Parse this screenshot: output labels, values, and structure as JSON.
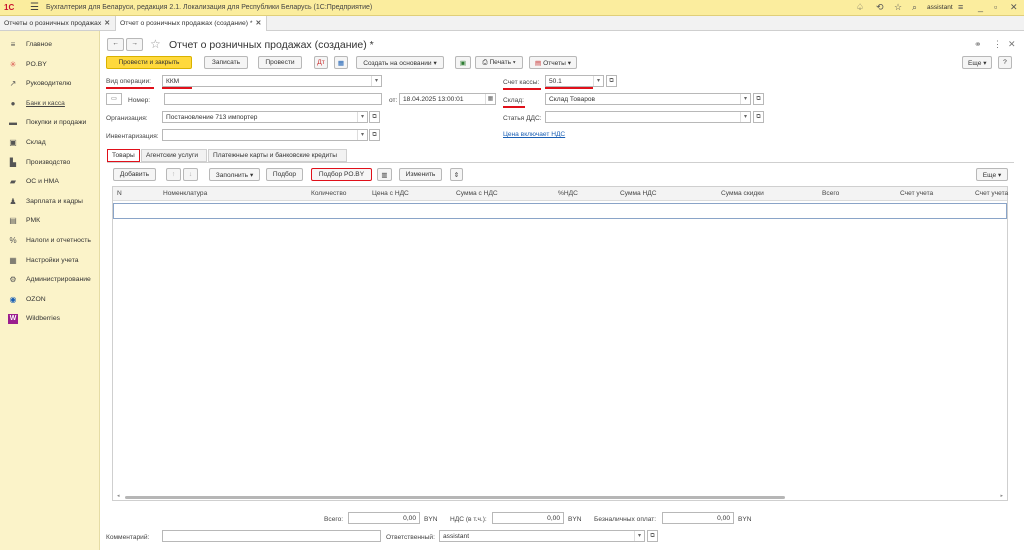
{
  "app": {
    "logo": "1С",
    "title": "Бухгалтерия для Беларуси, редакция 2.1. Локализация для Республики Беларусь  (1С:Предприятие)",
    "user": "assistant"
  },
  "tabs": [
    {
      "label": "Отчеты о розничных продажах"
    },
    {
      "label": "Отчет о розничных продажах (создание) *"
    }
  ],
  "sidebar": {
    "items": [
      {
        "label": "Главное",
        "icon": "≡"
      },
      {
        "label": "PO.BY",
        "icon": "✳"
      },
      {
        "label": "Руководителю",
        "icon": "↗"
      },
      {
        "label": "Банк и касса",
        "icon": "●"
      },
      {
        "label": "Покупки и продажи",
        "icon": "▬"
      },
      {
        "label": "Склад",
        "icon": "▣"
      },
      {
        "label": "Производство",
        "icon": "▙"
      },
      {
        "label": "ОС и НМА",
        "icon": "▰"
      },
      {
        "label": "Зарплата и кадры",
        "icon": "♟"
      },
      {
        "label": "РМК",
        "icon": "▤"
      },
      {
        "label": "Налоги и отчетность",
        "icon": "%"
      },
      {
        "label": "Настройки учета",
        "icon": "▦"
      },
      {
        "label": "Администрирование",
        "icon": "⚙"
      },
      {
        "label": "OZON",
        "icon": "◉"
      },
      {
        "label": "Wildberries",
        "icon": "W"
      }
    ]
  },
  "form": {
    "title": "Отчет о розничных продажах (создание) *",
    "toolbar": {
      "post_close": "Провести и закрыть",
      "save": "Записать",
      "post": "Провести",
      "create_based": "Создать на основании",
      "print": "Печать",
      "reports": "Отчеты",
      "more": "Еще",
      "help": "?"
    },
    "fields": {
      "operation_label": "Вид операции:",
      "operation_value": "ККМ",
      "number_label": "Номер:",
      "number_value": "",
      "date_label": "от:",
      "date_value": "18.04.2025 13:00:01",
      "org_label": "Организация:",
      "org_value": "Постановление 713 импортер",
      "inventory_label": "Инвентаризация:",
      "inventory_value": "",
      "cash_account_label": "Счет кассы:",
      "cash_account_value": "50.1",
      "warehouse_label": "Склад:",
      "warehouse_value": "Склад Товаров",
      "dds_label": "Статья ДДС:",
      "dds_value": "",
      "price_vat_link": "Цена включает НДС"
    },
    "tabs": [
      "Товары",
      "Агентские услуги",
      "Платежные карты и банковские кредиты"
    ],
    "table_toolbar": {
      "add": "Добавить",
      "fill": "Заполнить",
      "pick": "Подбор",
      "pick_po": "Подбор PO.BY",
      "change": "Изменить",
      "more": "Еще"
    },
    "columns": [
      "N",
      "Номенклатура",
      "Количество",
      "Цена с НДС",
      "Сумма с НДС",
      "%НДС",
      "Сумма НДС",
      "Сумма скидки",
      "Всего",
      "Счет учета",
      "Счет учета"
    ],
    "totals": {
      "total_label": "Всего:",
      "total_value": "0,00",
      "total_cur": "BYN",
      "vat_label": "НДС (в т.ч.):",
      "vat_value": "0,00",
      "vat_cur": "BYN",
      "cashless_label": "Безналичных оплат:",
      "cashless_value": "0,00",
      "cashless_cur": "BYN"
    },
    "comment_label": "Комментарий:",
    "comment_value": "",
    "responsible_label": "Ответственный:",
    "responsible_value": "assistant"
  },
  "colors": {
    "accent_yellow": "#ffd93c",
    "sidebar_bg": "#fbf3c9",
    "titlebar_bg": "#fbed9e",
    "highlight_red": "#e0101a",
    "link_blue": "#1a5fb4"
  }
}
